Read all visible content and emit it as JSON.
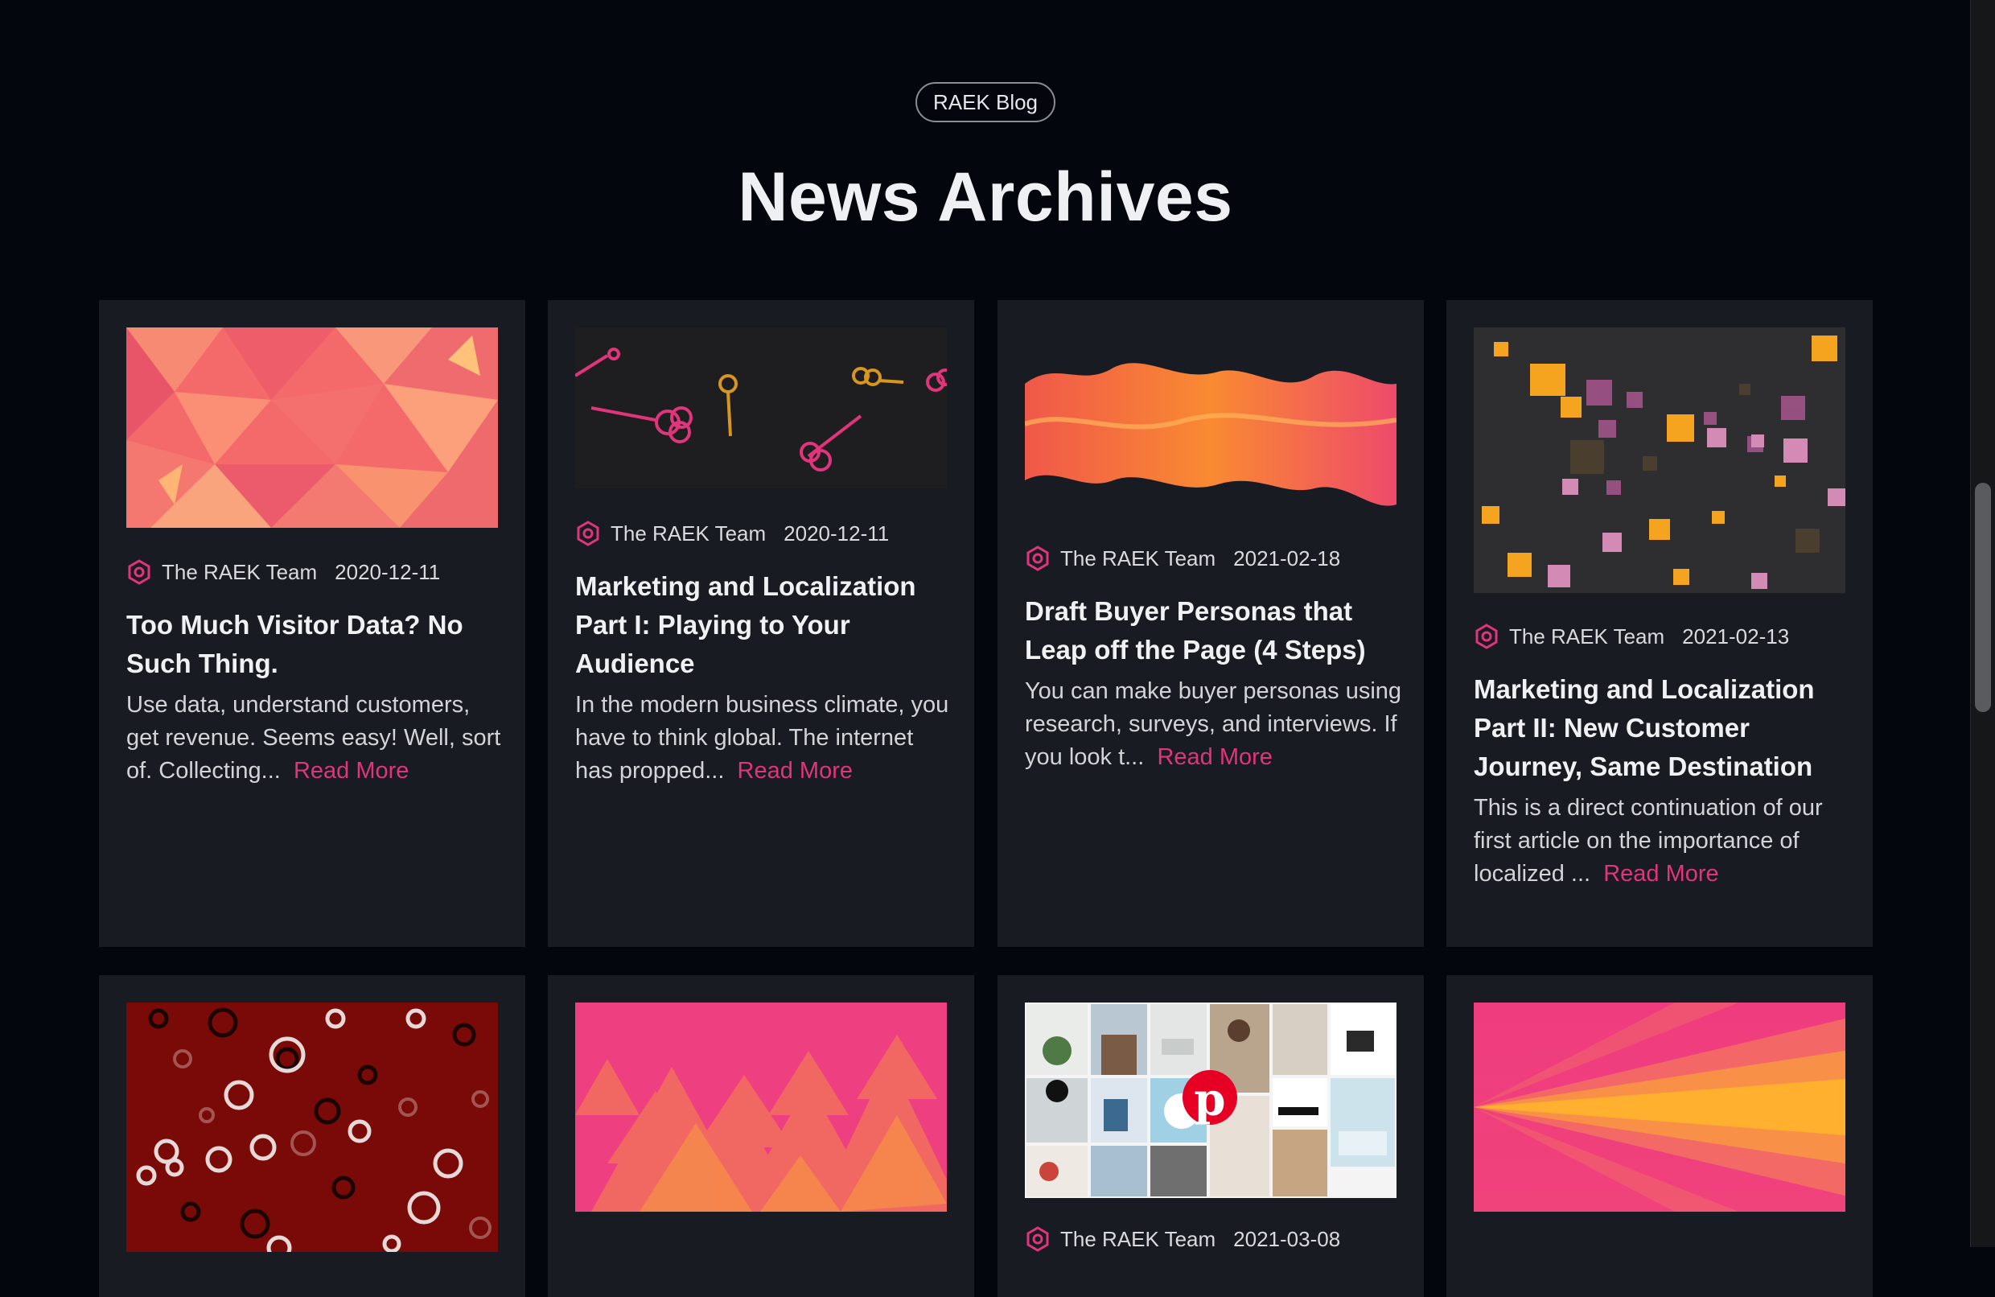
{
  "blog_pill": "RAEK Blog",
  "page_title": "News Archives",
  "colors": {
    "background": "#03060d",
    "card": "#181b21",
    "accent": "#e0357a"
  },
  "posts": [
    {
      "author": "The RAEK Team",
      "date": "2020-12-11",
      "title": "Too Much Visitor Data? No Such Thing.",
      "excerpt": "Use data, understand customers, get revenue. Seems easy! Well, sort of. Collecting...",
      "read_more": "Read More",
      "image": "pink-polygon-pattern"
    },
    {
      "author": "The RAEK Team",
      "date": "2020-12-11",
      "title": "Marketing and Localization Part I: Playing to Your Audience",
      "excerpt": "In the modern business climate, you have to think global. The internet has propped...",
      "read_more": "Read More",
      "image": "keys-illustration"
    },
    {
      "author": "The RAEK Team",
      "date": "2021-02-18",
      "title": "Draft Buyer Personas that Leap off the Page (4 Steps)",
      "excerpt": "You can make buyer personas using research, surveys, and interviews. If you look t...",
      "read_more": "Read More",
      "image": "orange-wave"
    },
    {
      "author": "The RAEK Team",
      "date": "2021-02-13",
      "title": "Marketing and Localization Part II: New Customer Journey, Same Destination",
      "excerpt": "This is a direct continuation of our first article on the importance of localized ...",
      "read_more": "Read More",
      "image": "scattered-squares"
    },
    {
      "image": "red-circles-pattern"
    },
    {
      "image": "pink-triangles"
    },
    {
      "author": "The RAEK Team",
      "date": "2021-03-08",
      "image": "pinterest-collage"
    },
    {
      "image": "orange-light-burst"
    }
  ]
}
